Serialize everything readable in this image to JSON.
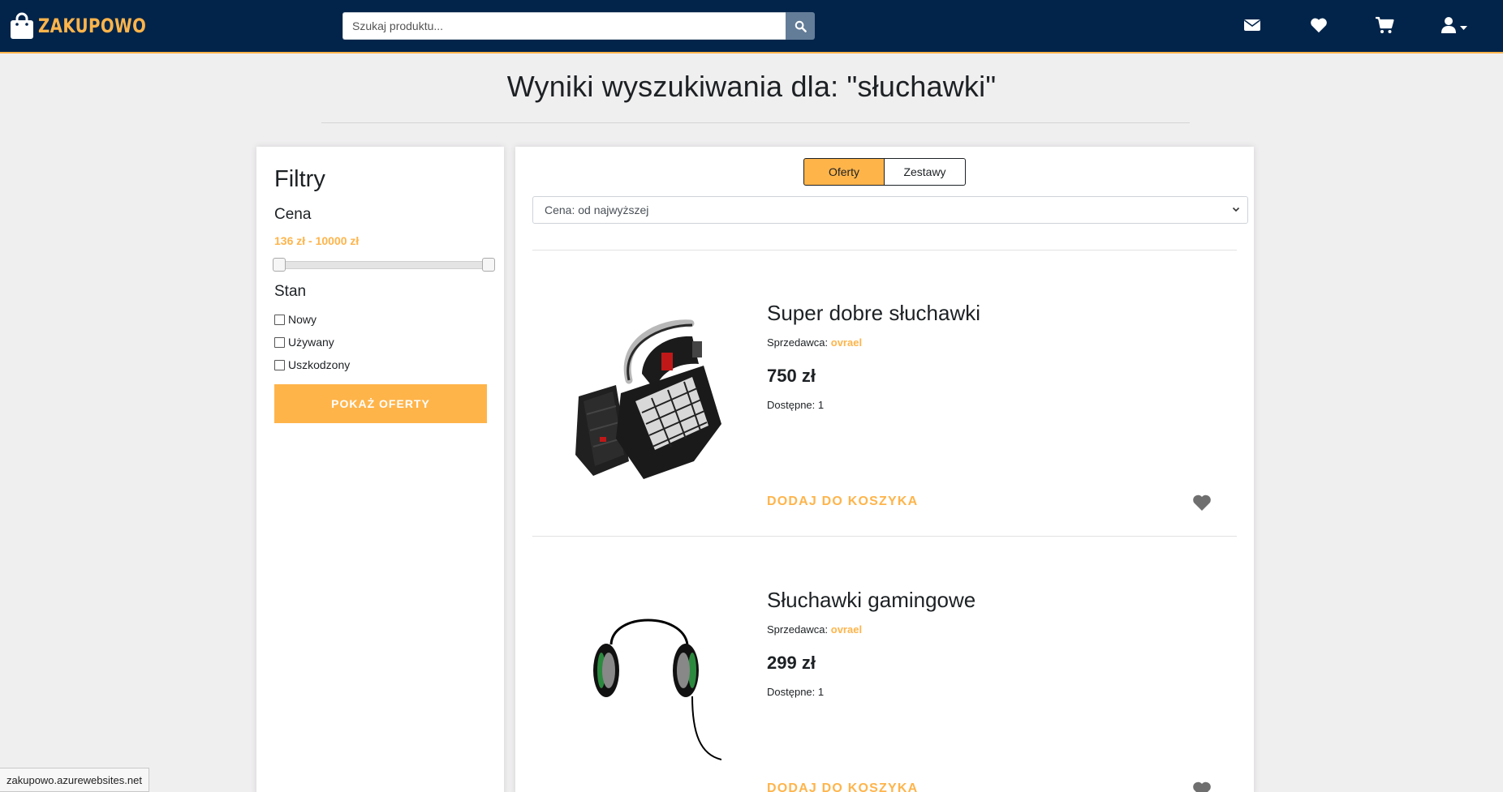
{
  "navbar": {
    "brand": "ZAKUPOWO",
    "search_placeholder": "Szukaj produktu...",
    "icons": [
      "envelope-icon",
      "heart-icon",
      "cart-icon",
      "user-icon"
    ],
    "colors": {
      "navbar": "#02244a",
      "accent": "#ffb44a"
    }
  },
  "page": {
    "title": "Wyniki wyszukiwania dla: \"słuchawki\""
  },
  "filters": {
    "heading": "Filtry",
    "price_heading": "Cena",
    "price_range": "136 zł - 10000 zł",
    "price_min": 136,
    "price_max": 10000,
    "condition_heading": "Stan",
    "conditions": [
      {
        "label": "Nowy",
        "checked": false
      },
      {
        "label": "Używany",
        "checked": false
      },
      {
        "label": "Uszkodzony",
        "checked": false
      }
    ],
    "submit_label": "POKAŻ OFERTY"
  },
  "results": {
    "tabs": [
      {
        "label": "Oferty",
        "active": true
      },
      {
        "label": "Zestawy",
        "active": false
      }
    ],
    "sort_selected": "Cena: od najwyższej",
    "seller_prefix": "Sprzedawca: ",
    "products": [
      {
        "name": "Super dobre słuchawki",
        "seller": "ovrael",
        "price": "750 zł",
        "availability": "Dostępne: 1",
        "add_label": "DODAJ DO KOSZYKA"
      },
      {
        "name": "Słuchawki gamingowe",
        "seller": "ovrael",
        "price": "299 zł",
        "availability": "Dostępne: 1",
        "add_label": "DODAJ DO KOSZYKA"
      }
    ]
  },
  "statusbar": {
    "url": "zakupowo.azurewebsites.net"
  }
}
